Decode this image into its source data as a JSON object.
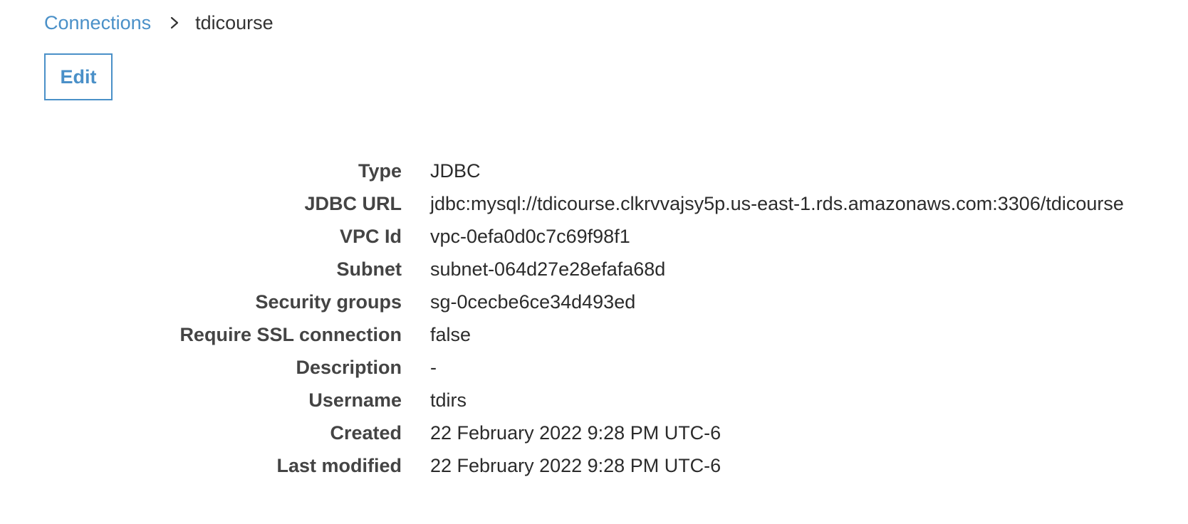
{
  "breadcrumb": {
    "parent": "Connections",
    "current": "tdicourse"
  },
  "actions": {
    "edit_label": "Edit"
  },
  "colors": {
    "link": "#4a90c8",
    "label": "#444444",
    "value": "#2b2b2b"
  },
  "details": [
    {
      "label": "Type",
      "value": "JDBC"
    },
    {
      "label": "JDBC URL",
      "value": "jdbc:mysql://tdicourse.clkrvvajsy5p.us-east-1.rds.amazonaws.com:3306/tdicourse"
    },
    {
      "label": "VPC Id",
      "value": "vpc-0efa0d0c7c69f98f1"
    },
    {
      "label": "Subnet",
      "value": "subnet-064d27e28efafa68d"
    },
    {
      "label": "Security groups",
      "value": "sg-0cecbe6ce34d493ed"
    },
    {
      "label": "Require SSL connection",
      "value": "false"
    },
    {
      "label": "Description",
      "value": "-"
    },
    {
      "label": "Username",
      "value": "tdirs"
    },
    {
      "label": "Created",
      "value": "22 February 2022 9:28 PM UTC-6"
    },
    {
      "label": "Last modified",
      "value": "22 February 2022 9:28 PM UTC-6"
    }
  ]
}
